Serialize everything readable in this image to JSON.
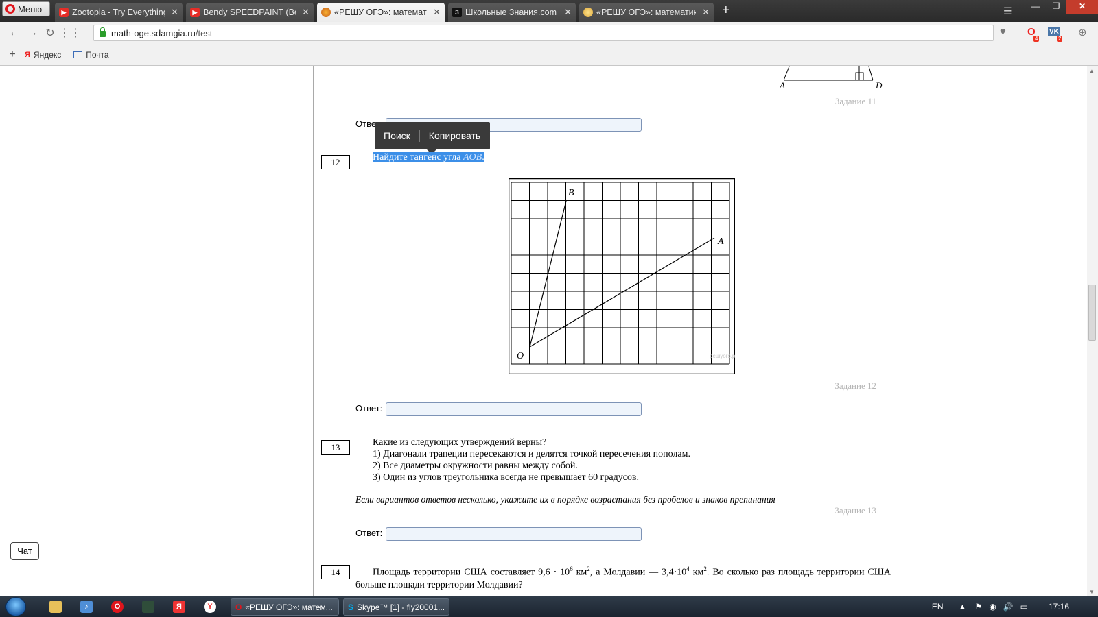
{
  "browser": {
    "menu_label": "Меню",
    "tabs": [
      {
        "title": "Zootopia - Try Everything",
        "icon": "youtube-icon",
        "active": false
      },
      {
        "title": "Bendy SPEEDPAINT (Bendy",
        "icon": "youtube-icon",
        "active": false
      },
      {
        "title": "«РЕШУ ОГЭ»: математика",
        "icon": "reshu-oge-icon",
        "active": true
      },
      {
        "title": "Школьные Знания.com - ",
        "icon": "znaniya-icon",
        "active": false
      },
      {
        "title": "«РЕШУ ОГЭ»: математика",
        "icon": "reshu-oge-icon",
        "active": false
      }
    ],
    "address": {
      "host": "math-oge.sdamgia.ru",
      "path": "/test"
    },
    "notification_badges": {
      "opera": "4",
      "vk": "2"
    },
    "bookmarks": [
      {
        "label": "Яндекс",
        "icon": "yandex-icon"
      },
      {
        "label": "Почта",
        "icon": "mail-icon"
      }
    ]
  },
  "page": {
    "context_popup": {
      "search": "Поиск",
      "copy": "Копировать"
    },
    "task11": {
      "label": "Задание 11",
      "figure_points": [
        "A",
        "D"
      ],
      "answer_label": "Ответ:"
    },
    "task12": {
      "number": "12",
      "question_prefix": "Найдите тангенс угла ",
      "question_var": "AOB",
      "question_suffix": ".",
      "figure_points": {
        "O": "O",
        "A": "A",
        "B": "B"
      },
      "watermark": "решуогэ.рф",
      "label": "Задание 12",
      "answer_label": "Ответ:"
    },
    "task13": {
      "number": "13",
      "lines": [
        "Какие из следующих утверждений верны?",
        "1) Диагонали трапеции пересекаются и делятся точкой пересечения пополам.",
        "2) Все диаметры окружности равны между собой.",
        "3) Один из углов треугольника всегда не превышает 60 градусов."
      ],
      "note": "Если вариантов ответов несколько, укажите их в порядке возрастания без пробелов и знаков препинания",
      "label": "Задание 13",
      "answer_label": "Ответ:"
    },
    "task14": {
      "number": "14",
      "text_part1": "Площадь территории США составляет 9,6 · 10",
      "exp1": "6",
      "text_part2": " км",
      "sq": "2",
      "text_part3": ", а Молдавии — 3,4·10",
      "exp2": "4",
      "text_part4": " км",
      "text_part5": ". Во сколько раз площадь территории",
      "text_line2": "США больше площади территории Молдавии?"
    },
    "chat_label": "Чат"
  },
  "taskbar": {
    "tasks": [
      {
        "title": "«РЕШУ ОГЭ»: матем...",
        "icon": "opera-icon"
      },
      {
        "title": "Skype™ [1] - fly20001...",
        "icon": "skype-icon"
      }
    ],
    "language": "EN",
    "clock": "17:16"
  }
}
